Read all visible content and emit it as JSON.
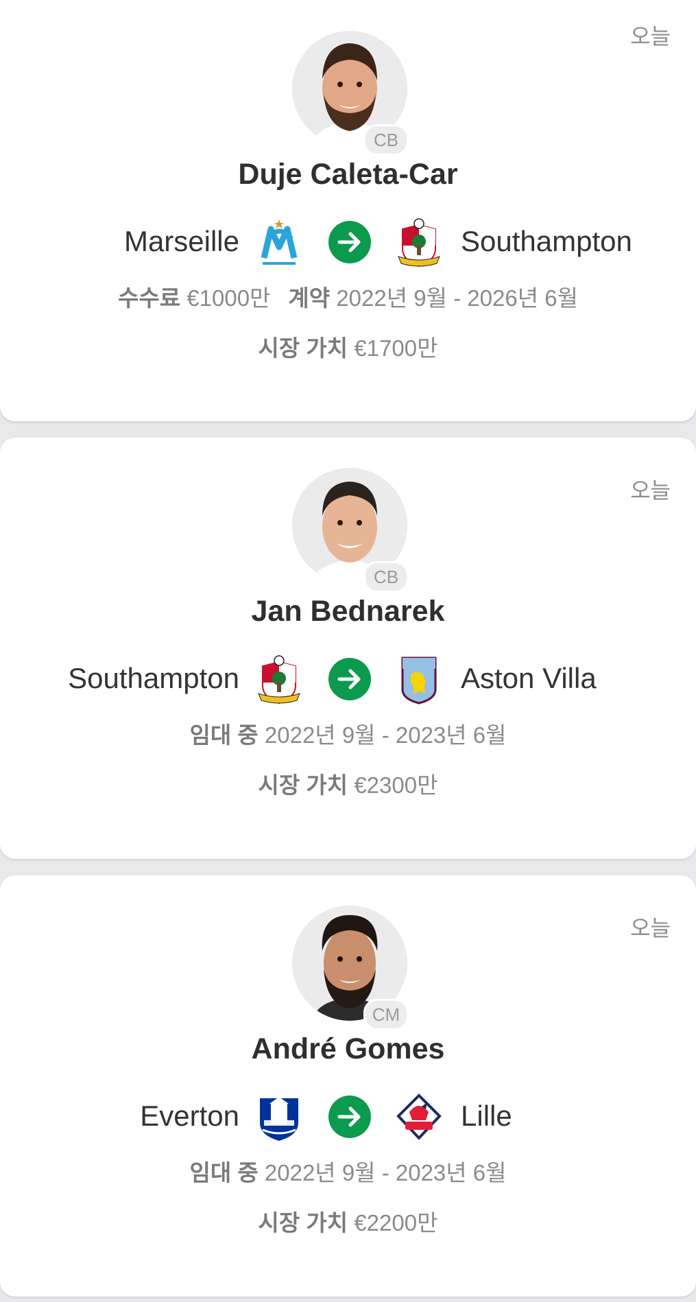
{
  "transfers": [
    {
      "date": "오늘",
      "player": "Duje Caleta-Car",
      "position": "CB",
      "from": "Marseille",
      "to": "Southampton",
      "fee_label": "수수료",
      "fee": "€1000만",
      "contract_label": "계약",
      "contract": "2022년 9월 - 2026년 6월",
      "market_value_label": "시장 가치",
      "market_value": "€1700만",
      "from_logo_icon": "marseille-crest-icon",
      "to_logo_icon": "southampton-crest-icon"
    },
    {
      "date": "오늘",
      "player": "Jan Bednarek",
      "position": "CB",
      "from": "Southampton",
      "to": "Aston Villa",
      "loan_label": "임대 중",
      "loan_period": "2022년 9월 - 2023년 6월",
      "market_value_label": "시장 가치",
      "market_value": "€2300만",
      "from_logo_icon": "southampton-crest-icon",
      "to_logo_icon": "aston-villa-crest-icon"
    },
    {
      "date": "오늘",
      "player": "André Gomes",
      "position": "CM",
      "from": "Everton",
      "to": "Lille",
      "loan_label": "임대 중",
      "loan_period": "2022년 9월 - 2023년 6월",
      "market_value_label": "시장 가치",
      "market_value": "€2200만",
      "from_logo_icon": "everton-crest-icon",
      "to_logo_icon": "lille-crest-icon"
    }
  ],
  "colors": {
    "arrow": "#0c9a4f",
    "background": "#e9e9ec",
    "card": "#ffffff"
  }
}
